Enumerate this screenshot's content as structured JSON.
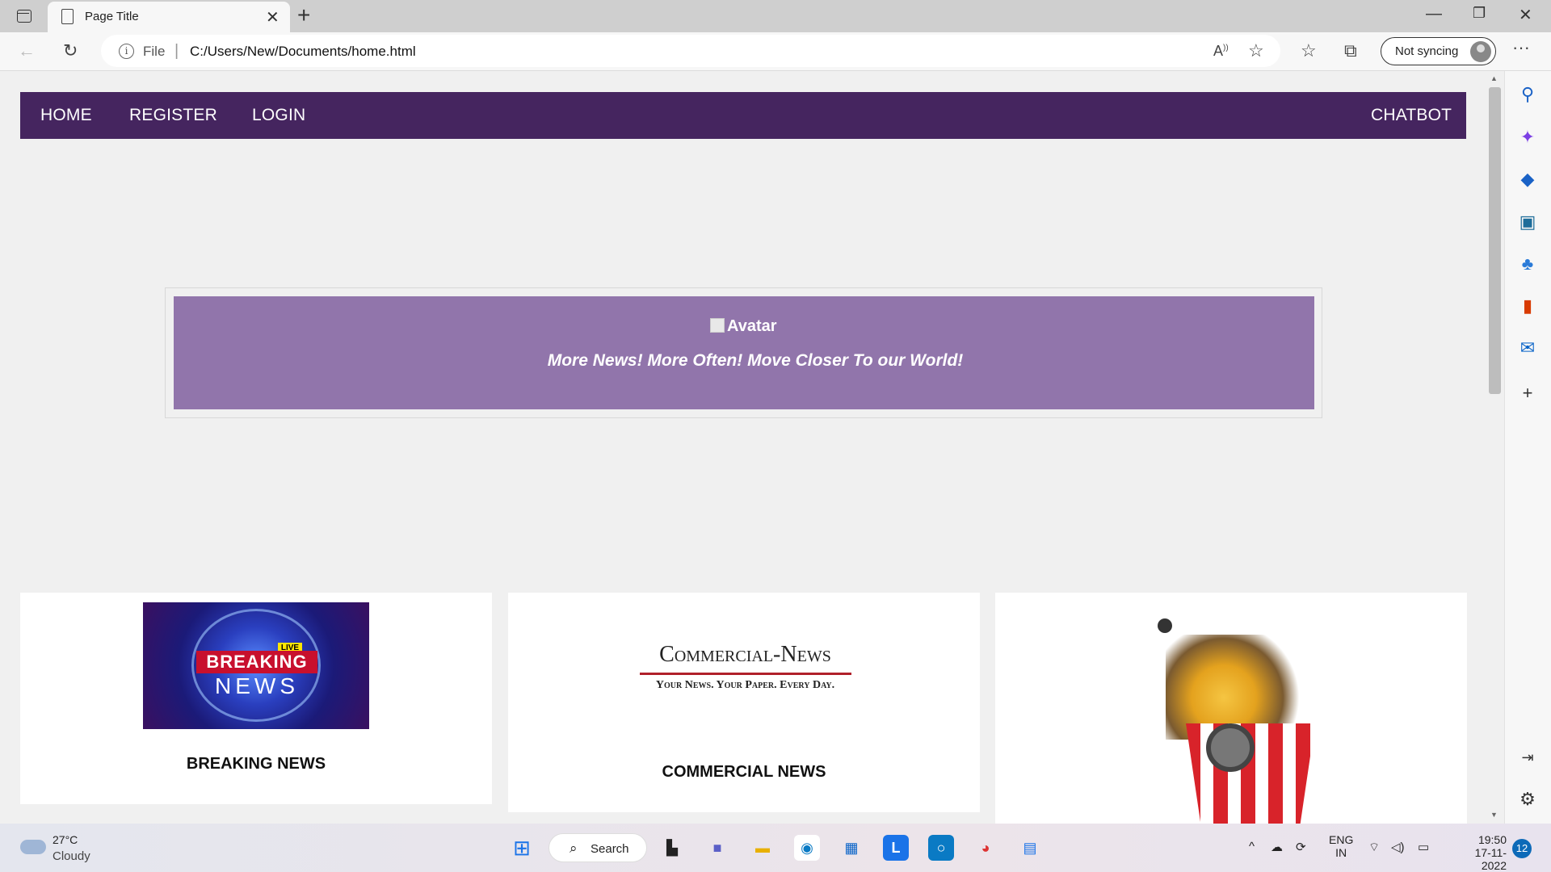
{
  "browser": {
    "tab_title": "Page Title",
    "address_prefix": "File",
    "url": "C:/Users/New/Documents/home.html",
    "sync_label": "Not syncing"
  },
  "nav": {
    "items": [
      {
        "label": "HOME"
      },
      {
        "label": "REGISTER"
      },
      {
        "label": "LOGIN"
      }
    ],
    "right_item": "CHATBOT",
    "bg_color": "#45255f"
  },
  "hero": {
    "image_alt": "Avatar",
    "tagline": "More News! More Often! Move Closer To our World!",
    "bg_color": "#9175ab"
  },
  "cards": [
    {
      "caption": "BREAKING NEWS",
      "image": "breaking-news-image",
      "image_text": {
        "live": "LIVE",
        "line1": "BREAKING",
        "line2": "NEWS"
      }
    },
    {
      "caption": "COMMERCIAL NEWS",
      "image": "commercial-news-logo",
      "logo_title": "Commercial-News",
      "logo_tagline": "Your News. Your Paper. Every Day."
    },
    {
      "caption": "",
      "image": "entertainment-image"
    }
  ],
  "taskbar": {
    "weather_temp": "27°C",
    "weather_cond": "Cloudy",
    "search_label": "Search",
    "lang_top": "ENG",
    "lang_bottom": "IN",
    "time": "19:50",
    "date": "17-11-2022",
    "notif_count": "12"
  }
}
